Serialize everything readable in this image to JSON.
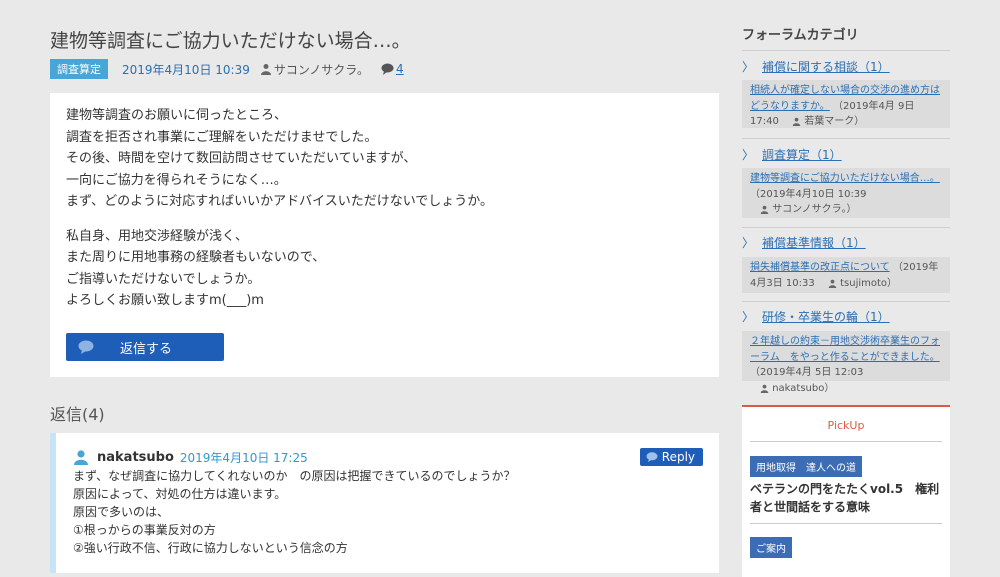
{
  "post": {
    "title": "建物等調査にご協力いただけない場合…。",
    "category": "調査算定",
    "date": "2019年4月10日 10:39",
    "author": "サコンノサクラ。",
    "comment_count": "4",
    "body_para1": [
      "建物等調査のお願いに伺ったところ、",
      "調査を拒否され事業にご理解をいただけませでした。",
      "その後、時間を空けて数回訪問させていただいていますが、",
      "一向にご協力を得られそうになく…。",
      "まず、どのように対応すればいいかアドバイスいただけないでしょうか。"
    ],
    "body_para2": [
      "私自身、用地交渉経験が浅く、",
      "また周りに用地事務の経験者もいないので、",
      "ご指導いただけないでしょうか。",
      "よろしくお願い致しますm(___)m"
    ],
    "reply_button": "返信する"
  },
  "replies": {
    "heading": "返信(4)",
    "first": {
      "name": "nakatsubo",
      "date": "2019年4月10日 17:25",
      "reply_label": "Reply",
      "lines": [
        "まず、なぜ調査に協力してくれないのか　の原因は把握できているのでしょうか？",
        "原因によって、対処の仕方は違います。",
        "原因で多いのは、",
        "①根っからの事業反対の方",
        "②強い行政不信、行政に協力しないという信念の方"
      ]
    }
  },
  "sidebar": {
    "title": "フォーラムカテゴリ",
    "categories": [
      {
        "label": "補償に関する相談（1）",
        "post_title": "相続人が確定しない場合の交渉の進め方はどうなりますか。",
        "post_meta": "（2019年4月 9日 17:40",
        "post_author": "若葉マーク）"
      },
      {
        "label": "調査算定（1）",
        "post_title": "建物等調査にご協力いただけない場合…。",
        "post_meta": "（2019年4月10日 10:39",
        "post_author": "サコンノサクラ。）"
      },
      {
        "label": "補償基準情報（1）",
        "post_title": "損失補償基準の改正点について",
        "post_meta": "（2019年4月3日 10:33",
        "post_author": "tsujimoto）"
      },
      {
        "label": "研修・卒業生の輪（1）",
        "post_title": "２年越しの約束－用地交渉術卒業生のフォーラム　をやっと作ることができました。",
        "post_meta": "（2019年4月 5日 12:03",
        "post_author": "nakatsubo）"
      }
    ],
    "pickup": {
      "title": "PickUp",
      "tag1": "用地取得　達人への道",
      "article": "ベテランの門をたたくvol.5　権利者と世間話をする意味",
      "tag2": "ご案内"
    }
  }
}
